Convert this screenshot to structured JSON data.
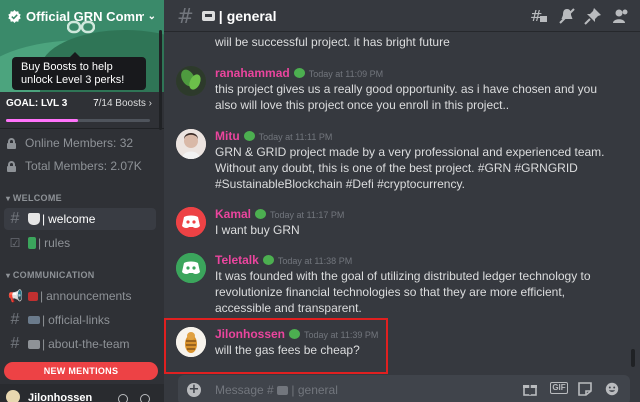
{
  "server": {
    "name": "Official GRN Commu",
    "tooltip": "Buy Boosts to help unlock Level 3 perks!",
    "goal_label": "GOAL: LVL 3",
    "boosts_current": "7",
    "boosts_text": "/14 Boosts",
    "boost_progress": 0.5
  },
  "stats": {
    "online": "Online Members: 32",
    "total": "Total Members: 2.07K"
  },
  "categories": {
    "welcome": "WELCOME",
    "communication": "COMMUNICATION"
  },
  "channels": [
    {
      "label": "welcome",
      "active": true
    },
    {
      "label": "rules",
      "active": false
    },
    {
      "label": "announcements",
      "active": false
    },
    {
      "label": "official-links",
      "active": false
    },
    {
      "label": "about-the-team",
      "active": false
    }
  ],
  "new_mentions": "NEW MENTIONS",
  "user": {
    "name": "Jilonhossen"
  },
  "channel_header": {
    "title": "general",
    "bar": "|"
  },
  "messages": [
    {
      "author": "",
      "time": "",
      "text": "wiil be successful project. it has bright future"
    },
    {
      "author": "ranahammad",
      "time": "Today at 11:09 PM",
      "text": "this project gives us a really good opportunity. as i have chosen and you also will love this project once you enroll in this project.."
    },
    {
      "author": "Mitu",
      "time": "Today at 11:11 PM",
      "text": "GRN & GRID project made by a very professional and experienced team. Without any doubt, this is one of the best project. #GRN #GRNGRID #SustainableBlockchain #Defi #cryptocurrency."
    },
    {
      "author": "Kamal",
      "time": "Today at 11:17 PM",
      "text": "I want buy GRN"
    },
    {
      "author": "Teletalk",
      "time": "Today at 11:38 PM",
      "text": "It was founded with the goal of utilizing distributed ledger technology to revolutionize financial technologies so that they are more efficient, accessible and transparent."
    },
    {
      "author": "Jilonhossen",
      "time": "Today at 11:39 PM",
      "text": "will the gas fees be cheap?"
    }
  ],
  "composer": {
    "placeholder": "Message #",
    "channel": "| general",
    "gif": "GIF"
  },
  "colors": {
    "author_pink": "#eb459e",
    "discord_red": "#ed4245",
    "discord_green": "#3ba55c",
    "boost_pink": "#ff73fa",
    "highlight_red": "#e02020"
  }
}
